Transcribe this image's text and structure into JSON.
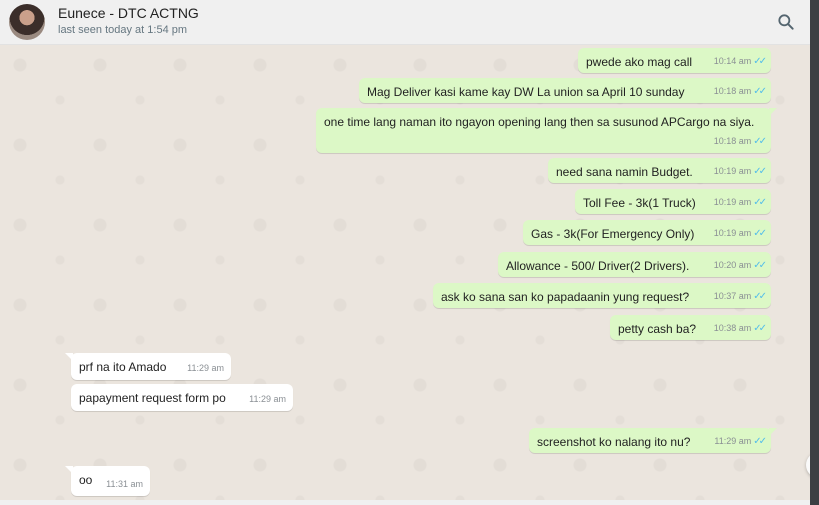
{
  "header": {
    "contact_name": "Eunece - DTC ACTNG",
    "last_seen": "last seen today at 1:54 pm",
    "search_icon": "search-icon"
  },
  "colors": {
    "outgoing_bubble": "#dcf8c6",
    "incoming_bubble": "#ffffff",
    "chat_background": "#ebe5de",
    "read_ticks": "#53bdeb"
  },
  "messages": [
    {
      "dir": "out",
      "text": "pwede ako mag call",
      "time": "10:14 am",
      "status": "read"
    },
    {
      "dir": "out",
      "text": "Mag Deliver kasi kame kay DW La union sa April 10 sunday",
      "time": "10:18 am",
      "status": "read"
    },
    {
      "dir": "out",
      "text": "one time lang naman ito ngayon opening lang then sa susunod APCargo na siya.",
      "time": "10:18 am",
      "status": "read"
    },
    {
      "dir": "out",
      "text": "need sana namin Budget.",
      "time": "10:19 am",
      "status": "read"
    },
    {
      "dir": "out",
      "text": "Toll Fee - 3k(1 Truck)",
      "time": "10:19 am",
      "status": "read"
    },
    {
      "dir": "out",
      "text": "Gas - 3k(For Emergency Only)",
      "time": "10:19 am",
      "status": "read"
    },
    {
      "dir": "out",
      "text": "Allowance - 500/ Driver(2 Drivers).",
      "time": "10:20 am",
      "status": "read"
    },
    {
      "dir": "out",
      "text": "ask ko sana san ko papadaanin yung request?",
      "time": "10:37 am",
      "status": "read"
    },
    {
      "dir": "out",
      "text": "petty cash ba?",
      "time": "10:38 am",
      "status": "read"
    },
    {
      "dir": "in",
      "text": "prf na ito Amado",
      "time": "11:29 am"
    },
    {
      "dir": "in",
      "text": "papayment request form po",
      "time": "11:29 am"
    },
    {
      "dir": "out",
      "text": "screenshot ko nalang ito nu?",
      "time": "11:29 am",
      "status": "read"
    },
    {
      "dir": "in",
      "text": "oo",
      "time": "11:31 am"
    }
  ]
}
